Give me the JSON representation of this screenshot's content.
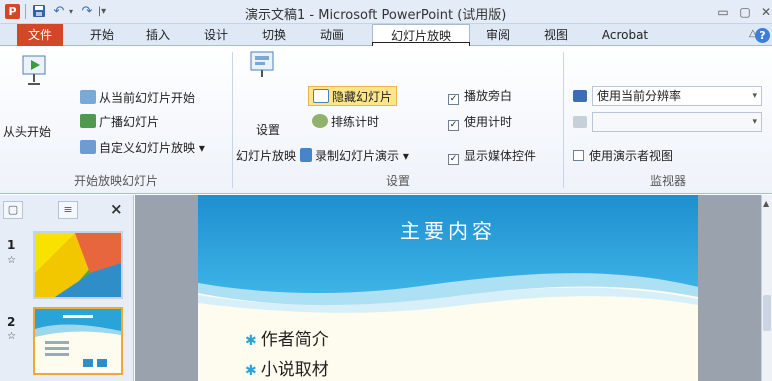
{
  "window": {
    "title": "演示文稿1 - Microsoft PowerPoint (试用版)",
    "app_logo": "P",
    "controls": {
      "minimize": "▭",
      "restore": "▢",
      "close": "✕"
    }
  },
  "quick_access": {
    "save_icon": "save-icon",
    "undo_icon": "undo-icon",
    "redo_icon": "redo-icon",
    "customize_icon": "customize-icon"
  },
  "tabs": {
    "file": "文件",
    "items": [
      "开始",
      "插入",
      "设计",
      "切换",
      "动画",
      "幻灯片放映",
      "审阅",
      "视图",
      "Acrobat"
    ],
    "active": "幻灯片放映",
    "help": "?"
  },
  "ribbon": {
    "start_group": {
      "from_beginning": "从头开始",
      "from_current": "从当前幻灯片开始",
      "broadcast": "广播幻灯片",
      "custom_show": "自定义幻灯片放映 ▾",
      "label": "开始放映幻灯片"
    },
    "setup_group": {
      "setup_show_line1": "设置",
      "setup_show_line2": "幻灯片放映",
      "hide_slide": "隐藏幻灯片",
      "rehearse": "排练计时",
      "record": "录制幻灯片演示 ▾",
      "play_narrations": "播放旁白",
      "use_timings": "使用计时",
      "show_media_controls": "显示媒体控件",
      "label": "设置"
    },
    "monitors_group": {
      "resolution": "使用当前分辨率",
      "show_on": "",
      "presenter_view": "使用演示者视图",
      "label": "监视器"
    },
    "colors": {
      "accent": "#d24726",
      "highlight": "#fde68a"
    }
  },
  "slides_pane": {
    "tab_slides": "▢",
    "tab_outline": "≡",
    "close": "×",
    "slides": [
      {
        "number": "1",
        "star": "☆"
      },
      {
        "number": "2",
        "star": "☆"
      }
    ]
  },
  "slide": {
    "title": "主要内容",
    "bullets": [
      "作者简介",
      "小说取材"
    ]
  }
}
